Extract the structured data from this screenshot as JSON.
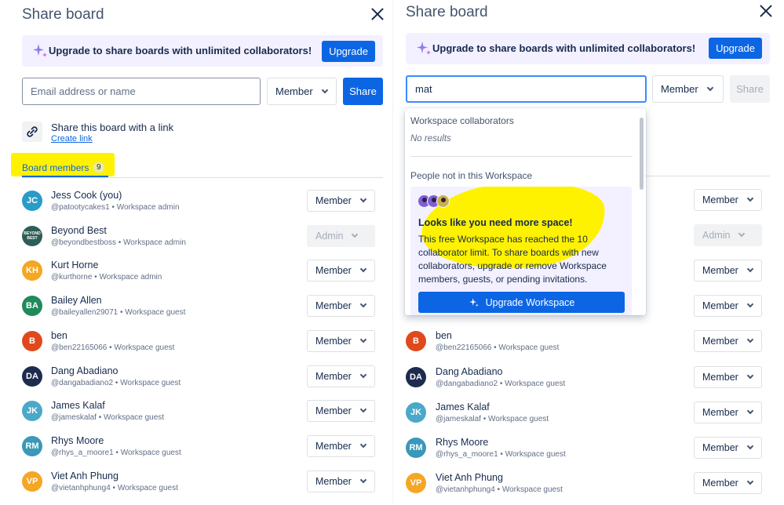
{
  "left": {
    "title": "Share board",
    "banner": {
      "text": "Upgrade to share boards with unlimited collaborators!",
      "button": "Upgrade"
    },
    "invite": {
      "placeholder": "Email address or name",
      "role": "Member",
      "share_button": "Share"
    },
    "link": {
      "title": "Share this board with a link",
      "create": "Create link"
    },
    "tab": {
      "label": "Board members",
      "count": "9"
    }
  },
  "right": {
    "title": "Share board",
    "banner": {
      "text": "Upgrade to share boards with unlimited collaborators!",
      "button": "Upgrade"
    },
    "invite": {
      "value": "mat",
      "role": "Member",
      "share_button": "Share"
    }
  },
  "dropdown": {
    "section1": "Workspace collaborators",
    "no_results": "No results",
    "section2": "People not in this Workspace",
    "card": {
      "title": "Looks like you need more space!",
      "text": "This free Workspace has reached the 10 collaborator limit. To share boards with new collaborators, upgrade or remove Workspace members, guests, or pending invitations.",
      "button": "Upgrade Workspace"
    }
  },
  "members": [
    {
      "initials": "JC",
      "name": "Jess Cook (you)",
      "sub": "@patootycakes1 • Workspace admin",
      "role": "Member",
      "color": "#2b9bc7"
    },
    {
      "initials": "BEYOND BEST",
      "name": "Beyond Best",
      "sub": "@beyondbestboss • Workspace admin",
      "role": "Admin",
      "color": "#2d5e56"
    },
    {
      "initials": "KH",
      "name": "Kurt Horne",
      "sub": "@kurthorne • Workspace admin",
      "role": "Member",
      "color": "#f5a623"
    },
    {
      "initials": "BA",
      "name": "Bailey Allen",
      "sub": "@baileyallen29071 • Workspace guest",
      "role": "Member",
      "color": "#1f8a5a"
    },
    {
      "initials": "B",
      "name": "ben",
      "sub": "@ben22165066 • Workspace guest",
      "role": "Member",
      "color": "#e0491b"
    },
    {
      "initials": "DA",
      "name": "Dang Abadiano",
      "sub": "@dangabadiano2 • Workspace guest",
      "role": "Member",
      "color": "#1d2b4f"
    },
    {
      "initials": "JK",
      "name": "James Kalaf",
      "sub": "@jameskalaf • Workspace guest",
      "role": "Member",
      "color": "#4aa8c9"
    },
    {
      "initials": "RM",
      "name": "Rhys Moore",
      "sub": "@rhys_a_moore1 • Workspace guest",
      "role": "Member",
      "color": "#3a98b9"
    },
    {
      "initials": "VP",
      "name": "Viet Anh Phung",
      "sub": "@vietanhphung4 • Workspace guest",
      "role": "Member",
      "color": "#f5a623"
    }
  ],
  "colors": {
    "accent": "#0c66e4",
    "highlight": "#fff200",
    "banner_bg": "#f3f0ff"
  },
  "icons": {
    "close": "close-icon",
    "sparkle": "sparkle-icon",
    "link": "link-icon",
    "chevron": "chevron-down-icon"
  }
}
